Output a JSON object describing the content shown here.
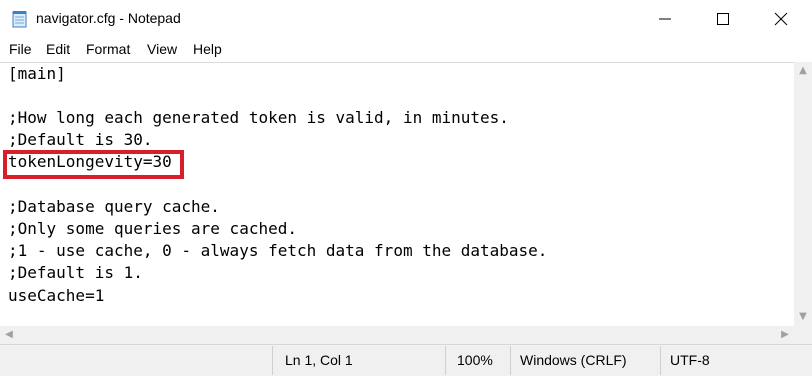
{
  "window": {
    "title": "navigator.cfg - Notepad",
    "icon": "notepad-icon",
    "controls": [
      "minimize-icon",
      "maximize-icon",
      "close-icon"
    ]
  },
  "menu": {
    "file": "File",
    "edit": "Edit",
    "format": "Format",
    "view": "View",
    "help": "Help"
  },
  "editor": {
    "lines": [
      "[main]",
      "",
      ";How long each generated token is valid, in minutes.",
      ";Default is 30.",
      "tokenLongevity=30",
      "",
      ";Database query cache.",
      ";Only some queries are cached.",
      ";1 - use cache, 0 - always fetch data from the database.",
      ";Default is 1.",
      "useCache=1"
    ],
    "highlight_color": "#d81e2a"
  },
  "status": {
    "position": "Ln 1, Col 1",
    "zoom": "100%",
    "line_ending": "Windows (CRLF)",
    "encoding": "UTF-8"
  }
}
